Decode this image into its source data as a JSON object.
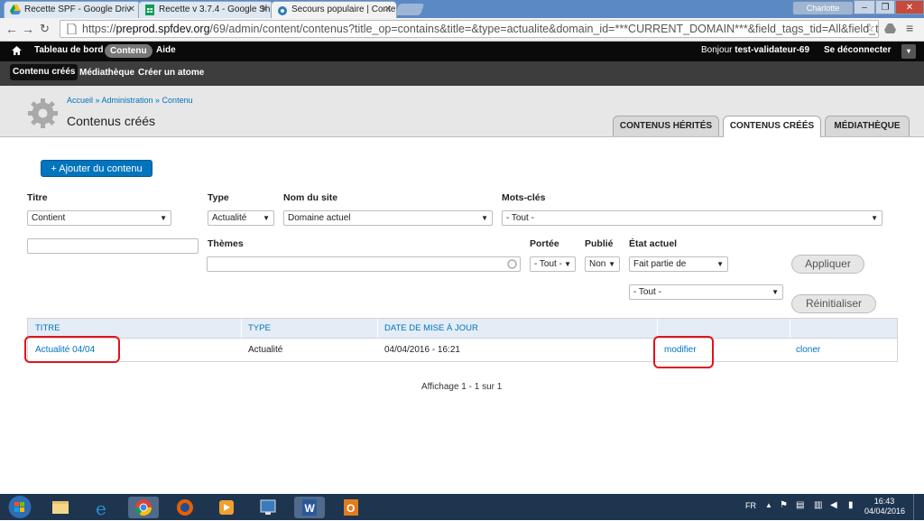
{
  "browser": {
    "tabs": [
      {
        "label": "Recette SPF - Google Driv",
        "icon": "google-drive-icon"
      },
      {
        "label": "Recette v 3.7.4 - Google Sh",
        "icon": "google-sheets-icon"
      },
      {
        "label": "Secours populaire | Conte",
        "icon": "drupal-icon"
      }
    ],
    "user": "Charlotte",
    "window_controls": [
      "–",
      "❐",
      "✕"
    ],
    "url_prefix": "https://",
    "url_host": "preprod.spfdev.org",
    "url_rest": "/69/admin/content/contenus?title_op=contains&title=&type=actualite&domain_id=***CURRENT_DOMAIN***&field_tags_tid=All&field_th"
  },
  "toolbar": {
    "home_icon": "home-icon",
    "dashboard": "Tableau de bord",
    "content": "Contenu",
    "help": "Aide",
    "greeting": "Bonjour",
    "username": "test-validateur-69",
    "logout": "Se déconnecter"
  },
  "subtoolbar": {
    "items": [
      "Contenu créés",
      "Médiathèque",
      "Créer un atome"
    ]
  },
  "header": {
    "breadcrumb": "Accueil » Administration » Contenu",
    "title": "Contenus créés",
    "tabs": [
      "CONTENUS HÉRITÉS",
      "CONTENUS CRÉÉS",
      "MÉDIATHÈQUE"
    ]
  },
  "actions": {
    "add_content": "+ Ajouter du contenu"
  },
  "filters": {
    "titre_label": "Titre",
    "titre_op": "Contient",
    "titre_value": "",
    "type_label": "Type",
    "type_value": "Actualité",
    "site_label": "Nom du site",
    "site_value": "Domaine actuel",
    "tags_label": "Mots-clés",
    "tags_value": "- Tout -",
    "themes_label": "Thèmes",
    "themes_value": "",
    "portee_label": "Portée",
    "portee_value": "- Tout -",
    "publie_label": "Publié",
    "publie_value": "Non",
    "etat_label": "État actuel",
    "etat_op": "Fait partie de",
    "etat_value": "- Tout -",
    "apply": "Appliquer",
    "reset": "Réinitialiser"
  },
  "table": {
    "headers": [
      "TITRE",
      "TYPE",
      "DATE DE MISE À JOUR",
      "",
      ""
    ],
    "rows": [
      {
        "title": "Actualité 04/04",
        "type": "Actualité",
        "date": "04/04/2016 - 16:21",
        "edit": "modifier",
        "clone": "cloner"
      }
    ]
  },
  "pager": "Affichage 1 - 1 sur 1",
  "taskbar": {
    "lang": "FR",
    "time": "16:43",
    "date": "04/04/2016"
  },
  "colors": {
    "link": "#0074bd",
    "toolbar": "#0a0a0a",
    "highlight": "#e0141c",
    "taskbar": "#1e3550"
  }
}
